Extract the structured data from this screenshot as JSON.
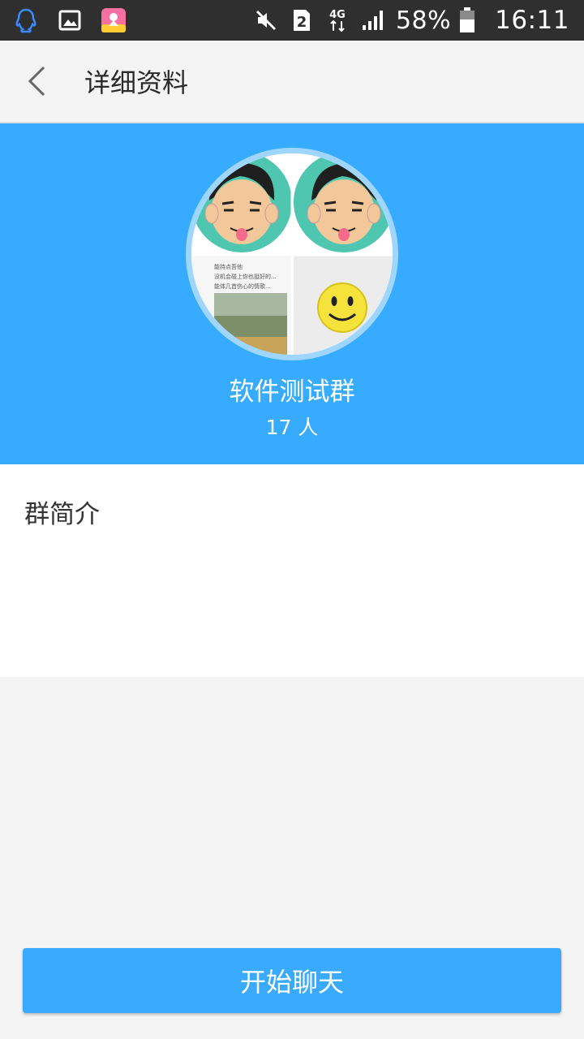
{
  "status_bar": {
    "icons_left": [
      "qq-icon",
      "gallery-icon",
      "app-icon"
    ],
    "icons_right": [
      "mute-icon",
      "sim-icon",
      "network-4g-icon",
      "signal-icon",
      "battery-icon"
    ],
    "sim_number": "2",
    "network": "4G",
    "battery": "58%",
    "time": "16:11"
  },
  "title_bar": {
    "title": "详细资料"
  },
  "group": {
    "name": "软件测试群",
    "member_count": "17 人",
    "avatar_texts": [
      "能持点吾他",
      "没机会碰上你也挺好的...",
      "能体几首伤心的情歌..."
    ]
  },
  "intro": {
    "title": "群简介"
  },
  "actions": {
    "start_chat_label": "开始聊天"
  },
  "colors": {
    "header_bg": "#36abff",
    "button_bg": "#3aaaff",
    "page_bg": "#f4f4f4"
  }
}
